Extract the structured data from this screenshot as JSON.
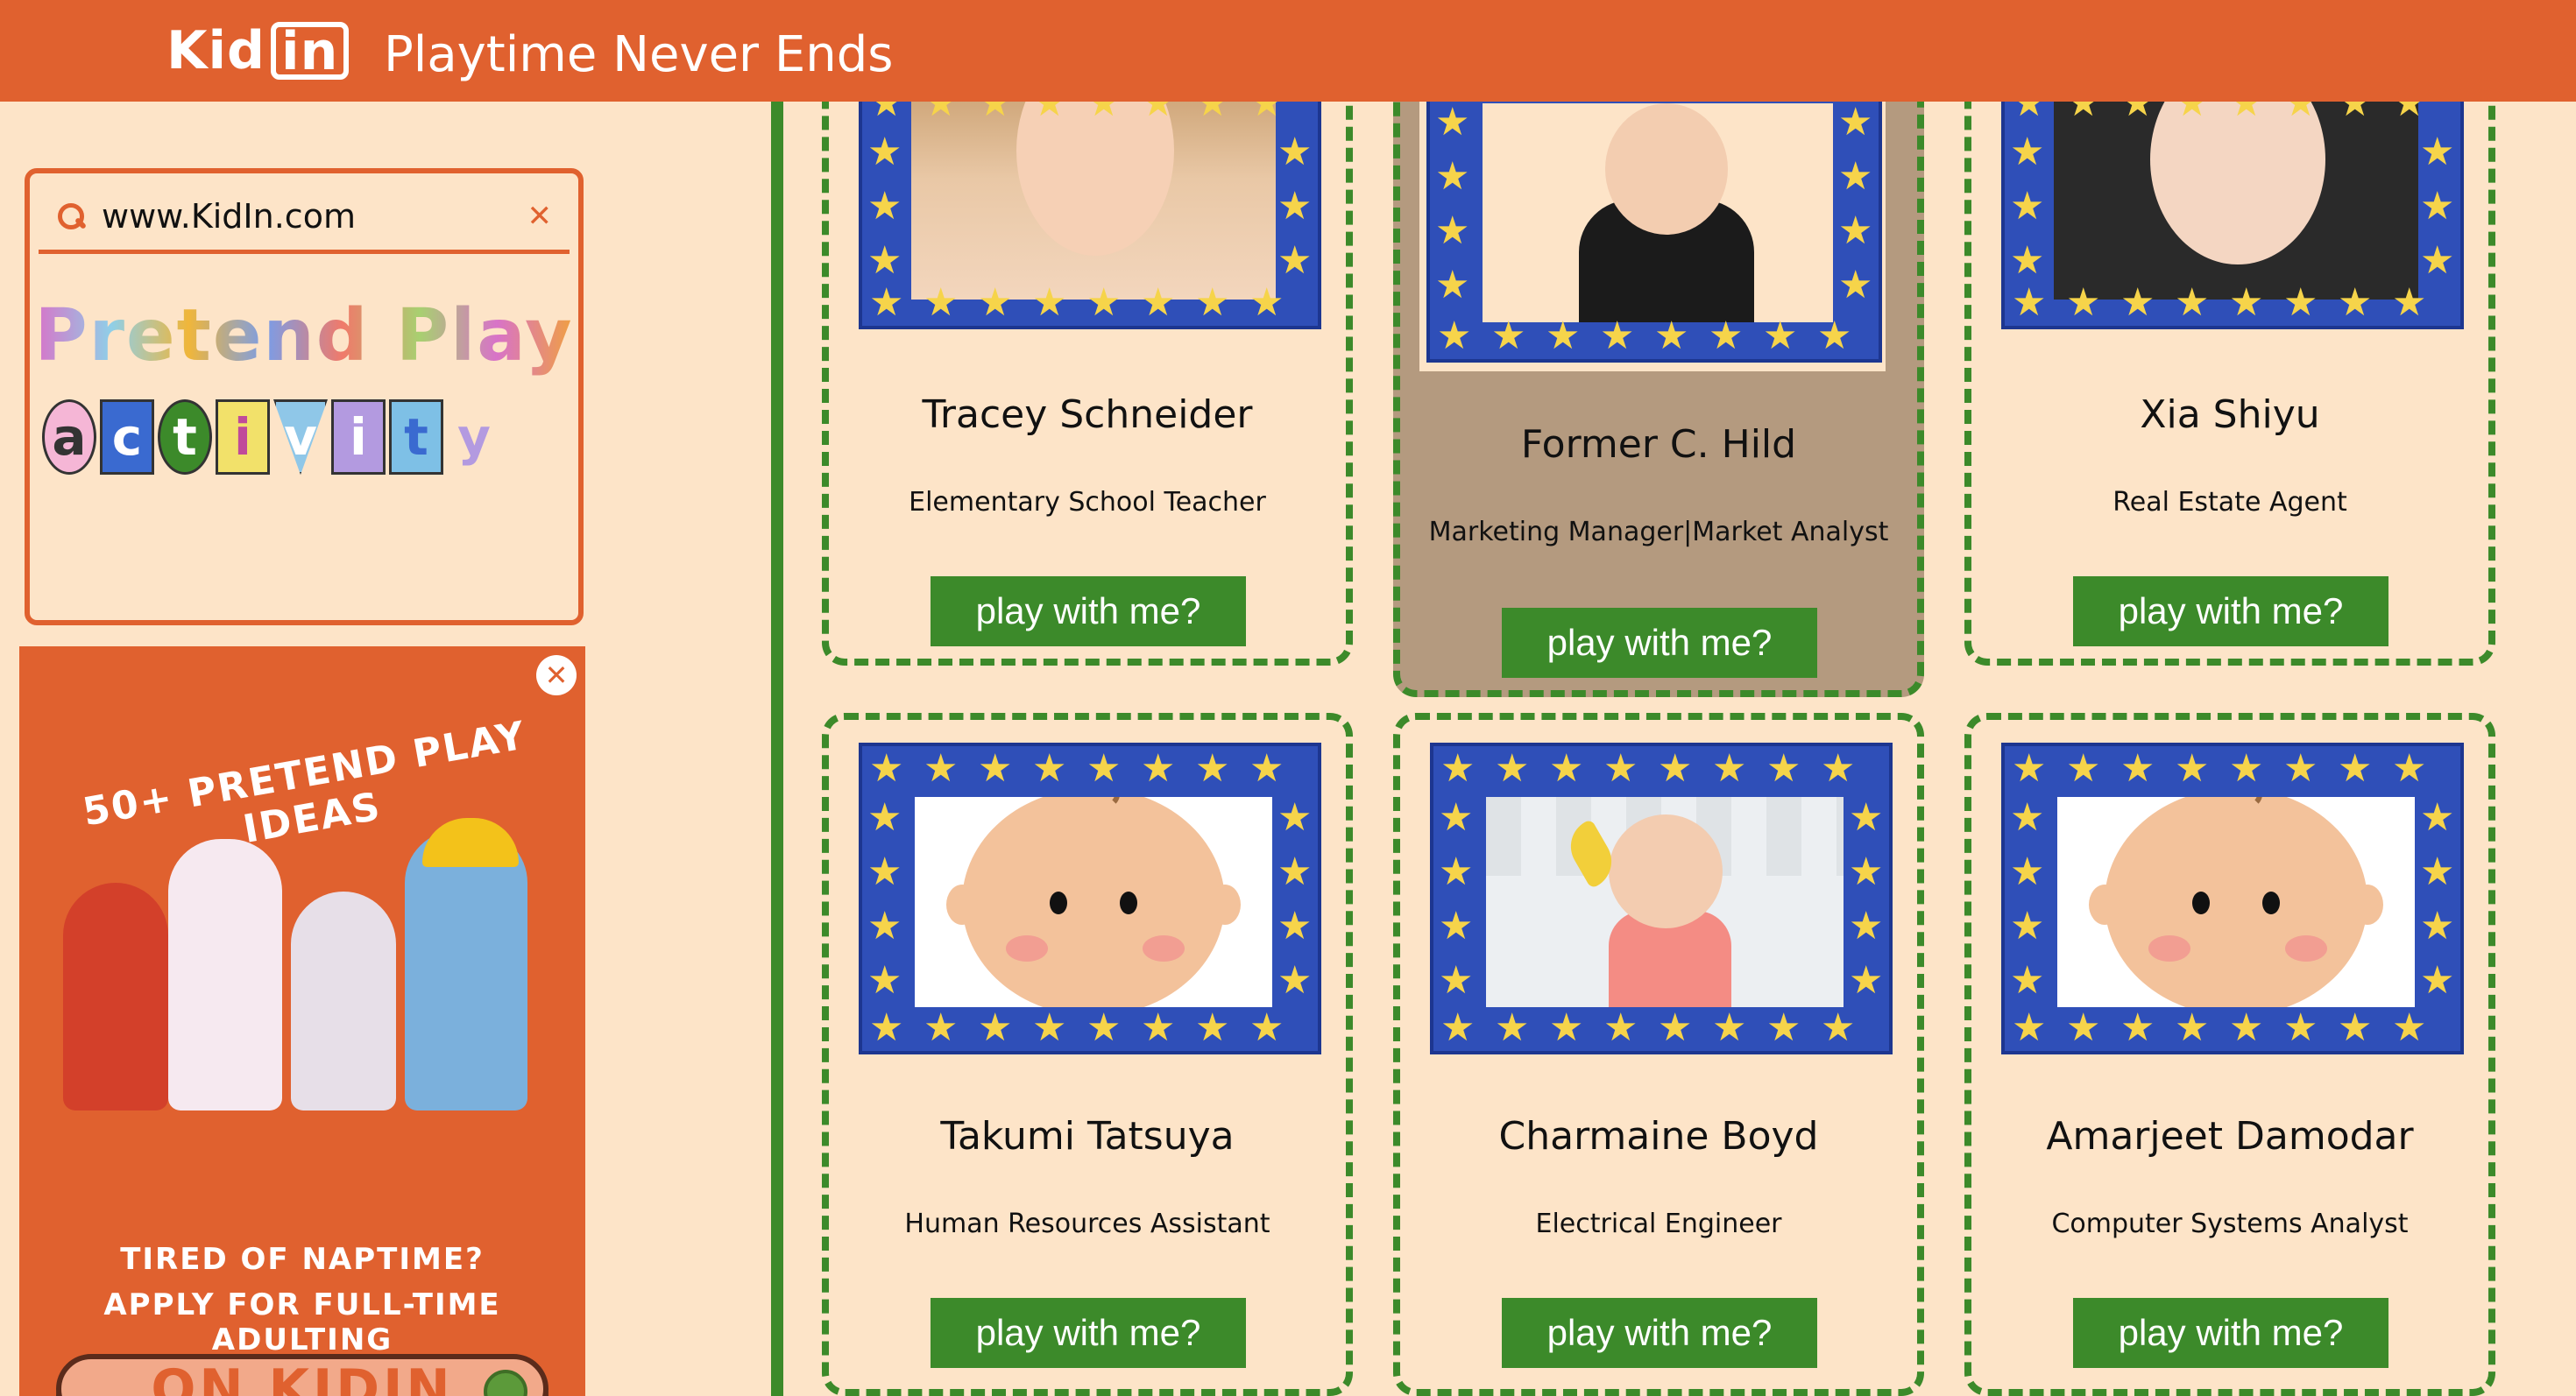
{
  "header": {
    "logo_text": "Kid",
    "logo_box": "in",
    "tagline": "Playtime Never Ends"
  },
  "sidebar": {
    "search_value": "www.KidIn.com",
    "panel_title": "Pretend Play",
    "panel_word": "activity",
    "ad": {
      "headline": "50+ PRETEND PLAY IDEAS",
      "line1": "TIRED OF NAPTIME?",
      "line2": "APPLY FOR FULL-TIME ADULTING",
      "cta": "ON KIDIN"
    }
  },
  "profiles": [
    {
      "name": "Tracey Schneider",
      "role": "Elementary School Teacher",
      "button": "play with me?"
    },
    {
      "name": "Former C. Hild",
      "role": "Marketing Manager|Market Analyst",
      "button": "play with me?"
    },
    {
      "name": "Xia Shiyu",
      "role": "Real Estate Agent",
      "button": "play with me?"
    },
    {
      "name": "Takumi Tatsuya",
      "role": "Human Resources Assistant",
      "button": "play with me?"
    },
    {
      "name": "Charmaine Boyd",
      "role": "Electrical Engineer",
      "button": "play with me?"
    },
    {
      "name": "Amarjeet Damodar",
      "role": "Computer Systems Analyst",
      "button": "play with me?"
    }
  ],
  "colors": {
    "header": "#e0612f",
    "background": "#fde4c8",
    "accent_green": "#3c8a2a",
    "frame_blue": "#2f4fb8",
    "star_yellow": "#f6d44a"
  }
}
